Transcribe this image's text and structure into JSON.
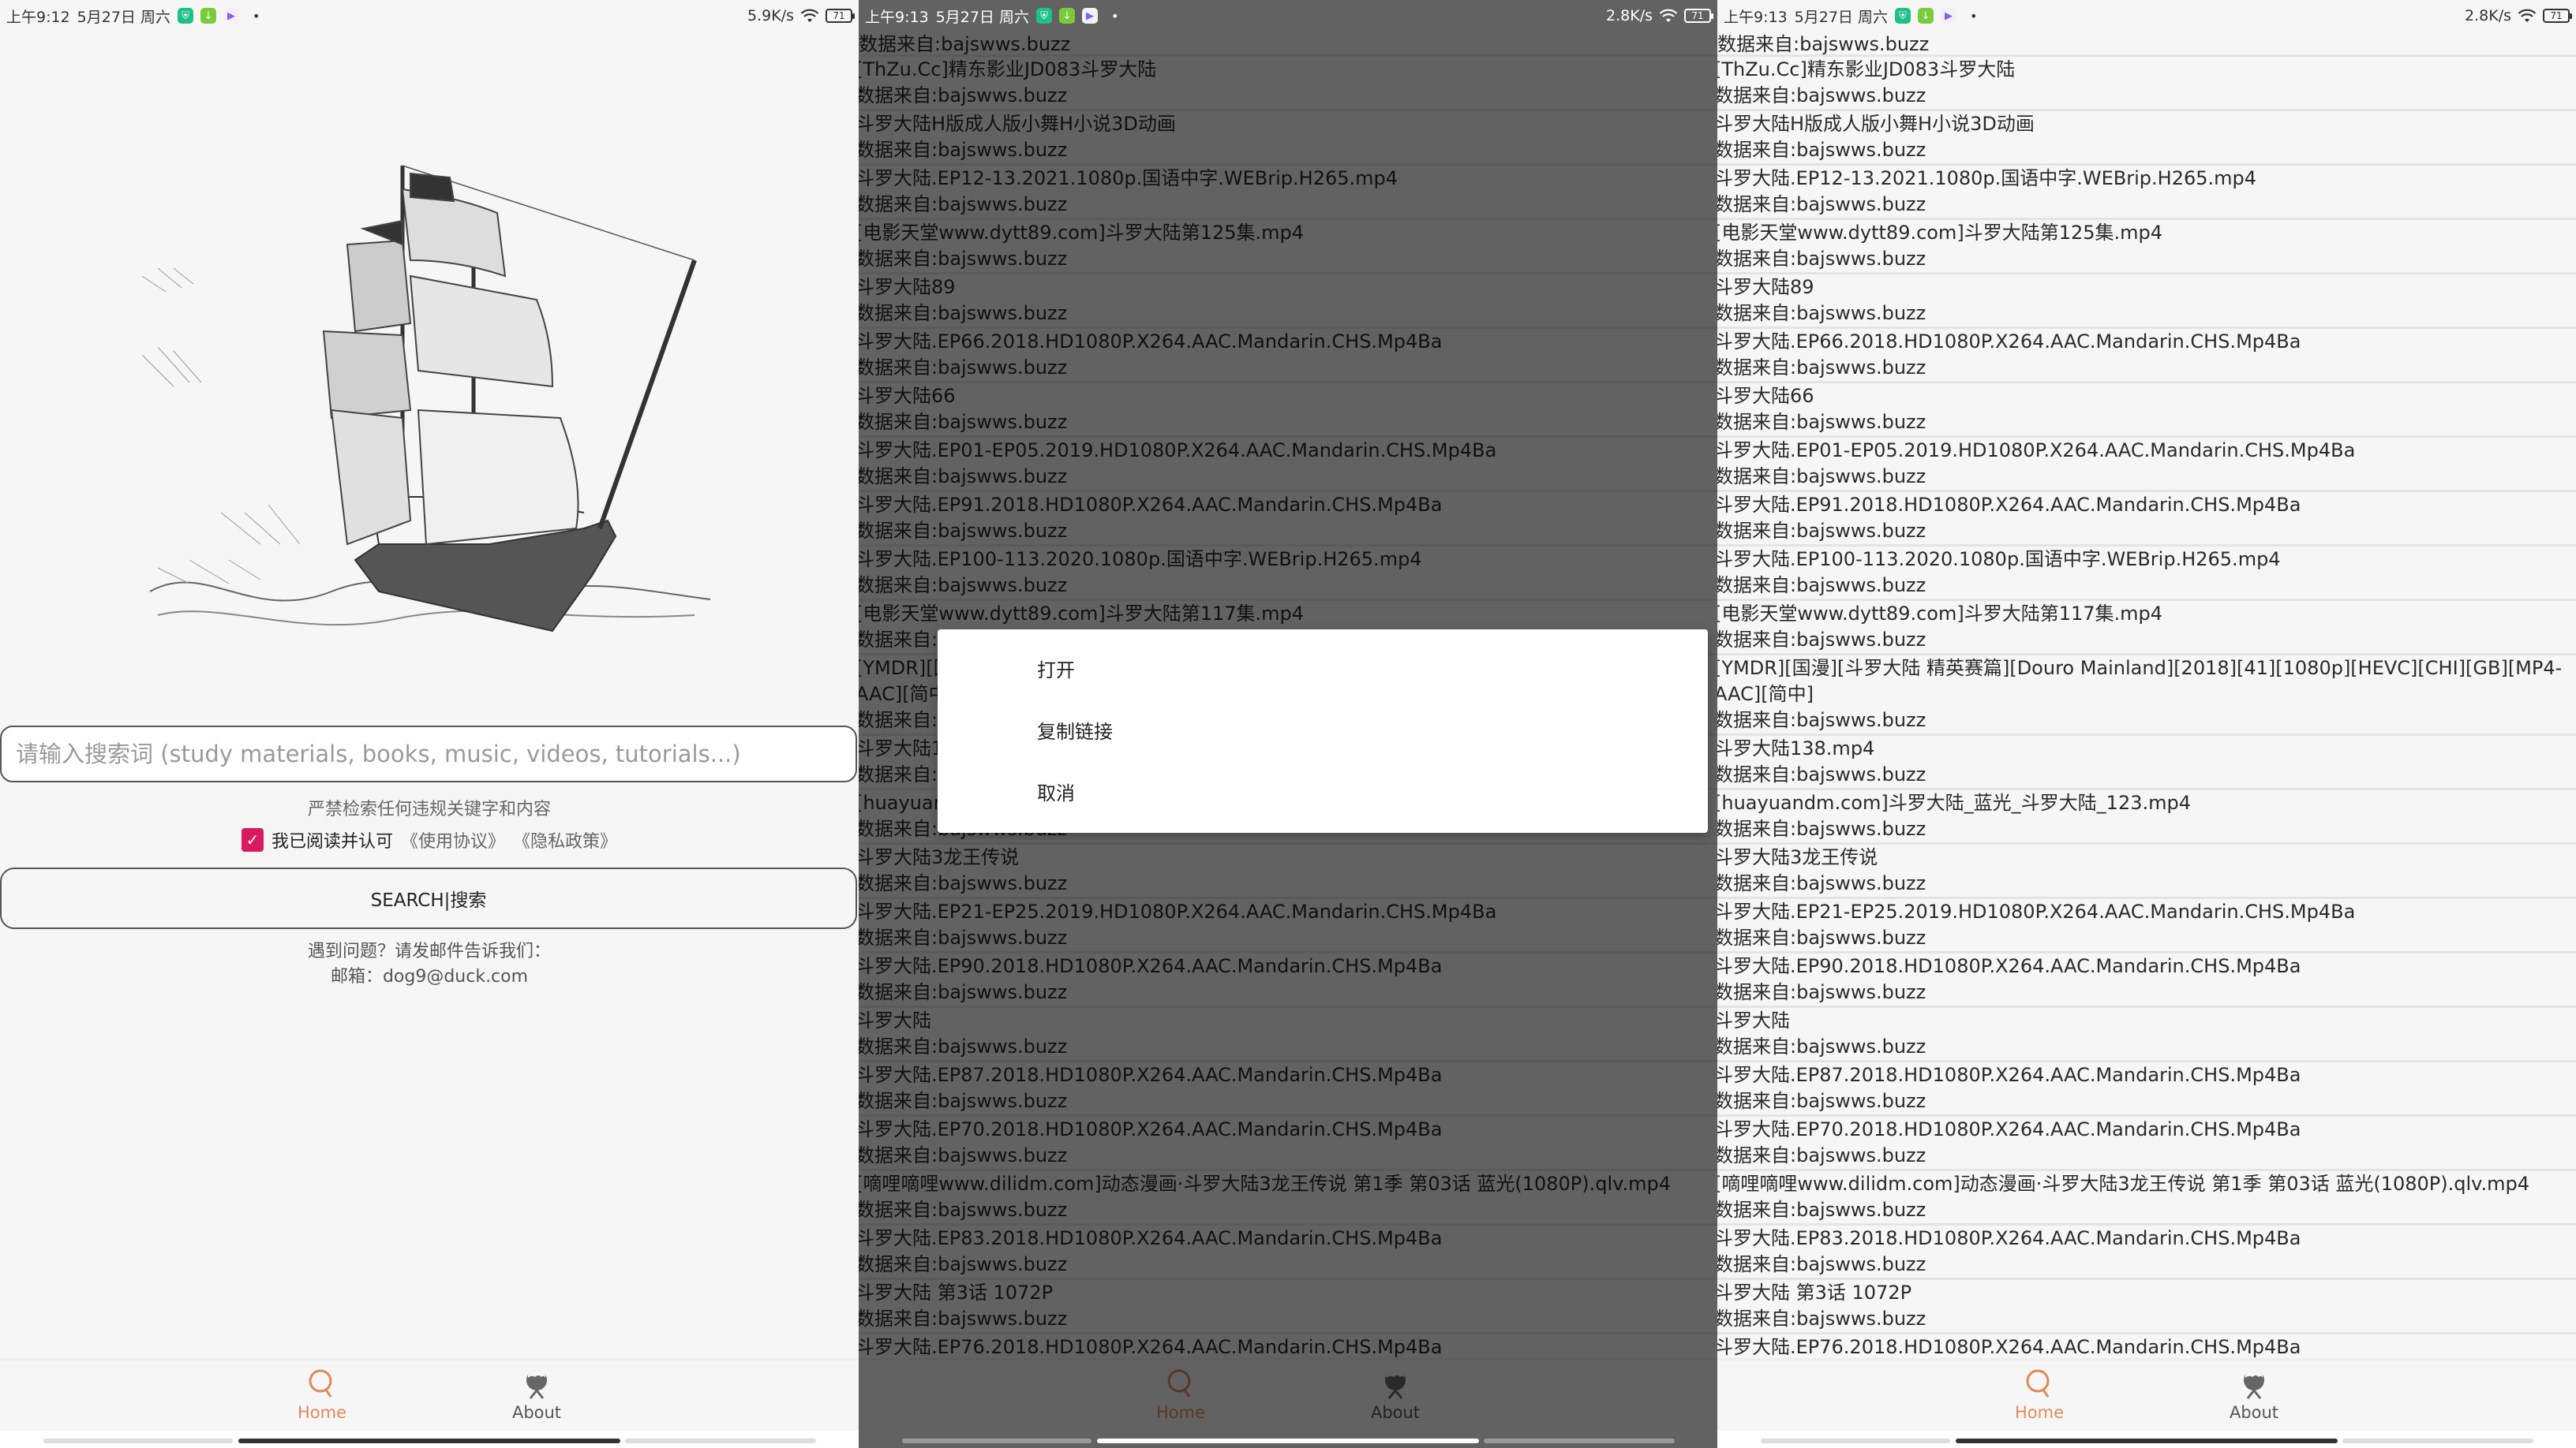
{
  "panels": {
    "home": {
      "status": {
        "time": "上午9:12",
        "date": "5月27日 周六",
        "net_speed": "5.9K/s",
        "battery": "71"
      },
      "search": {
        "placeholder": "请输入搜索词 (study materials, books, music, videos, tutorials...)"
      },
      "notice": "严禁检索任何违规关键字和内容",
      "agreement": {
        "checked": true,
        "text": "我已阅读并认可",
        "terms": "《使用协议》",
        "privacy": "《隐私政策》"
      },
      "search_button": "SEARCH|搜索",
      "contact": {
        "line1": "遇到问题？请发邮件告诉我们：",
        "line2": "邮箱：dog9@duck.com"
      }
    },
    "results_dialog": {
      "status": {
        "time": "上午9:13",
        "date": "5月27日 周六",
        "net_speed": "2.8K/s",
        "battery": "71"
      },
      "dialog": {
        "items": [
          "打开",
          "复制链接",
          "取消"
        ]
      }
    },
    "results": {
      "status": {
        "time": "上午9:13",
        "date": "5月27日 周六",
        "net_speed": "2.8K/s",
        "battery": "71"
      }
    }
  },
  "results_list": {
    "source_prefix": "数据来自:bajswws.buzz",
    "items": [
      {
        "title": "[ThZu.Cc]精东影业JD083斗罗大陆",
        "source": "数据来自:bajswws.buzz"
      },
      {
        "title": "斗罗大陆H版成人版小舞H小说3D动画",
        "source": "数据来自:bajswws.buzz"
      },
      {
        "title": "斗罗大陆.EP12-13.2021.1080p.国语中字.WEBrip.H265.mp4",
        "source": "数据来自:bajswws.buzz"
      },
      {
        "title": "[电影天堂www.dytt89.com]斗罗大陆第125集.mp4",
        "source": "数据来自:bajswws.buzz"
      },
      {
        "title": "斗罗大陆89",
        "source": "数据来自:bajswws.buzz"
      },
      {
        "title": "斗罗大陆.EP66.2018.HD1080P.X264.AAC.Mandarin.CHS.Mp4Ba",
        "source": "数据来自:bajswws.buzz"
      },
      {
        "title": "斗罗大陆66",
        "source": "数据来自:bajswws.buzz"
      },
      {
        "title": "斗罗大陆.EP01-EP05.2019.HD1080P.X264.AAC.Mandarin.CHS.Mp4Ba",
        "source": "数据来自:bajswws.buzz"
      },
      {
        "title": "斗罗大陆.EP91.2018.HD1080P.X264.AAC.Mandarin.CHS.Mp4Ba",
        "source": "数据来自:bajswws.buzz"
      },
      {
        "title": "斗罗大陆.EP100-113.2020.1080p.国语中字.WEBrip.H265.mp4",
        "source": "数据来自:bajswws.buzz"
      },
      {
        "title": "[电影天堂www.dytt89.com]斗罗大陆第117集.mp4",
        "source": "数据来自:bajswws.buzz"
      },
      {
        "title": "[YMDR][国漫][斗罗大陆 精英赛篇][Douro Mainland][2018][41][1080p][HEVC][CHI][GB][MP4-AAC][简中]",
        "source": "数据来自:bajswws.buzz",
        "wrap": true
      },
      {
        "title": "斗罗大陆138.mp4",
        "source": "数据来自:bajswws.buzz"
      },
      {
        "title": "[huayuandm.com]斗罗大陆_蓝光_斗罗大陆_123.mp4",
        "source": "数据来自:bajswws.buzz"
      },
      {
        "title": "斗罗大陆3龙王传说",
        "source": "数据来自:bajswws.buzz"
      },
      {
        "title": "斗罗大陆.EP21-EP25.2019.HD1080P.X264.AAC.Mandarin.CHS.Mp4Ba",
        "source": "数据来自:bajswws.buzz"
      },
      {
        "title": "斗罗大陆.EP90.2018.HD1080P.X264.AAC.Mandarin.CHS.Mp4Ba",
        "source": "数据来自:bajswws.buzz"
      },
      {
        "title": "斗罗大陆",
        "source": "数据来自:bajswws.buzz"
      },
      {
        "title": "斗罗大陆.EP87.2018.HD1080P.X264.AAC.Mandarin.CHS.Mp4Ba",
        "source": "数据来自:bajswws.buzz"
      },
      {
        "title": "斗罗大陆.EP70.2018.HD1080P.X264.AAC.Mandarin.CHS.Mp4Ba",
        "source": "数据来自:bajswws.buzz"
      },
      {
        "title": "[嘀哩嘀哩www.dilidm.com]动态漫画·斗罗大陆3龙王传说 第1季 第03话 蓝光(1080P).qlv.mp4",
        "source": "数据来自:bajswws.buzz"
      },
      {
        "title": "斗罗大陆.EP83.2018.HD1080P.X264.AAC.Mandarin.CHS.Mp4Ba",
        "source": "数据来自:bajswws.buzz"
      },
      {
        "title": "斗罗大陆 第3话 1072P",
        "source": "数据来自:bajswws.buzz"
      },
      {
        "title": "斗罗大陆.EP76.2018.HD1080P.X264.AAC.Mandarin.CHS.Mp4Ba",
        "source": "数据来自:bajswws.buzz"
      }
    ]
  },
  "bottom_nav": {
    "items": [
      {
        "label": "Home",
        "icon": "search-icon",
        "active": true
      },
      {
        "label": "About",
        "icon": "about-icon",
        "active": false
      }
    ]
  },
  "colors": {
    "accent": "#e08a5a",
    "checkbox": "#d81b60",
    "background": "#f6f6f6",
    "scrim": "rgba(0,0,0,0.6)"
  }
}
